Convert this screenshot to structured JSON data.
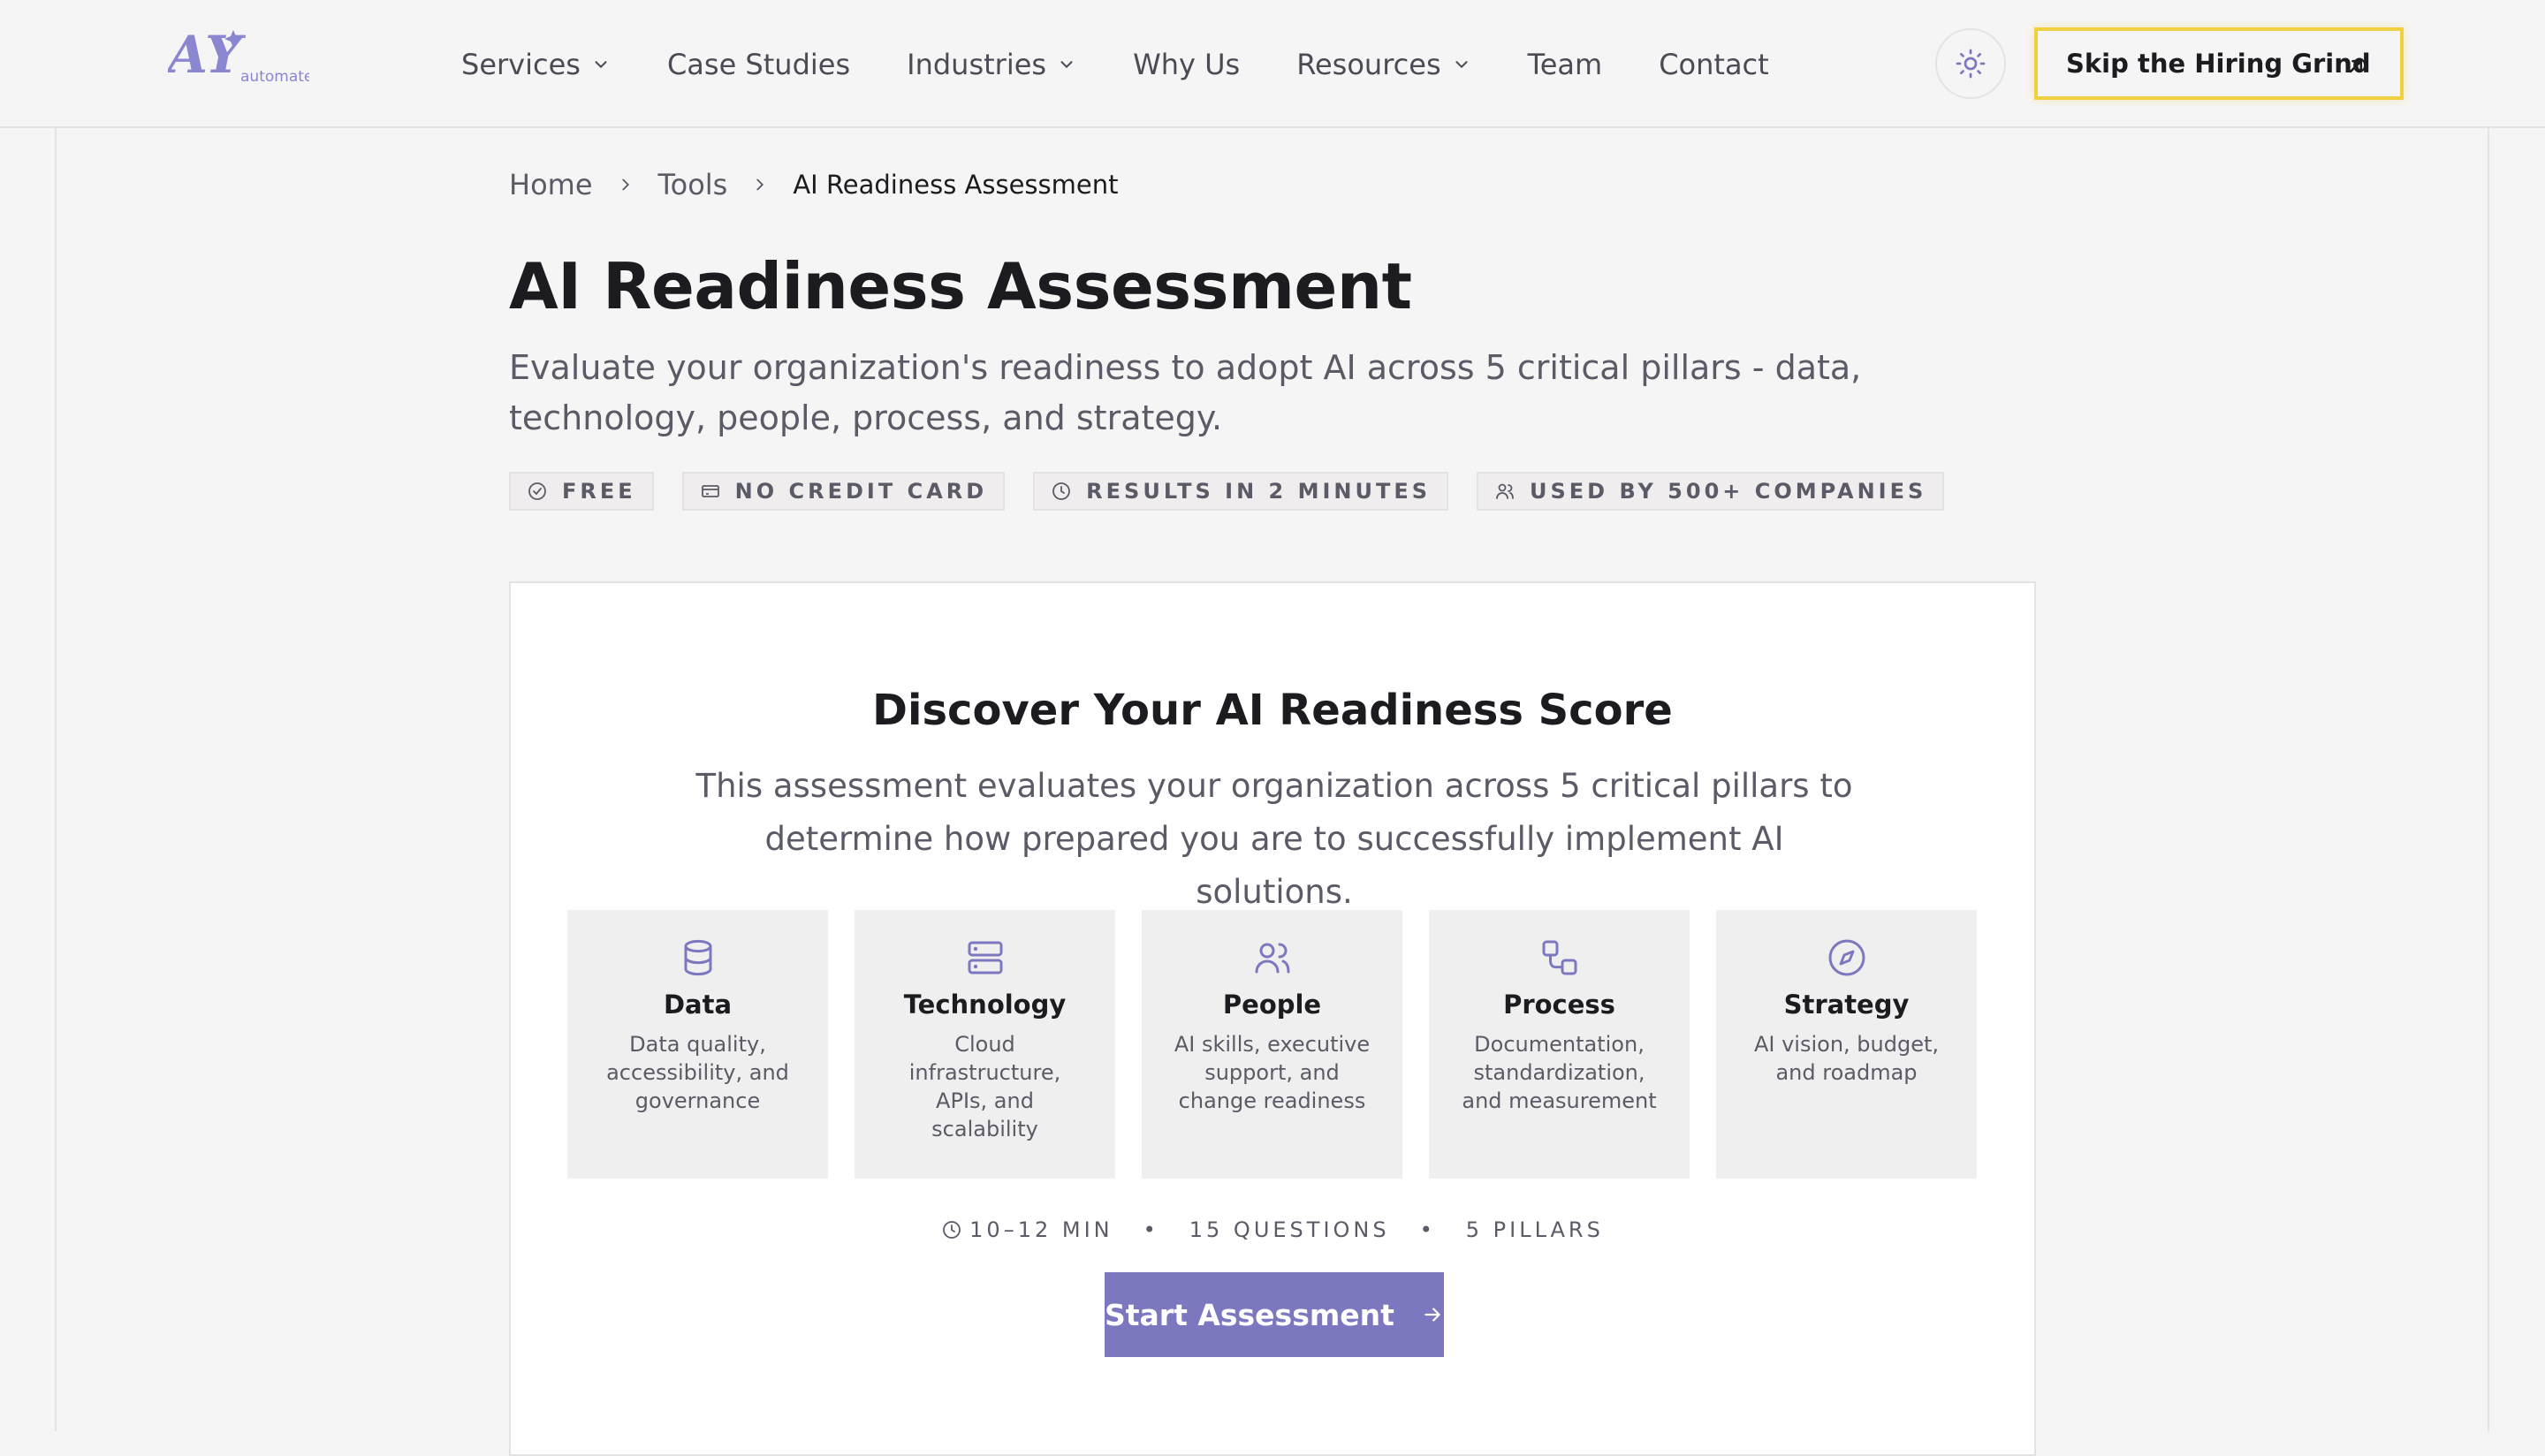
{
  "header": {
    "logo_text": "automate",
    "nav": [
      {
        "label": "Services",
        "dropdown": true
      },
      {
        "label": "Case Studies",
        "dropdown": false
      },
      {
        "label": "Industries",
        "dropdown": true
      },
      {
        "label": "Why Us",
        "dropdown": false
      },
      {
        "label": "Resources",
        "dropdown": true
      },
      {
        "label": "Team",
        "dropdown": false
      },
      {
        "label": "Contact",
        "dropdown": false
      }
    ],
    "theme_toggle_icon": "sun-icon",
    "cta_label": "Skip the Hiring Grind"
  },
  "breadcrumb": {
    "items": [
      "Home",
      "Tools"
    ],
    "current": "AI Readiness Assessment"
  },
  "page": {
    "title": "AI Readiness Assessment",
    "description": "Evaluate your organization's readiness to adopt AI across 5 critical pillars - data, technology, people, process, and strategy.",
    "badges": [
      {
        "icon": "check-circle-icon",
        "label": "FREE"
      },
      {
        "icon": "credit-card-icon",
        "label": "NO CREDIT CARD"
      },
      {
        "icon": "clock-icon",
        "label": "RESULTS IN 2 MINUTES"
      },
      {
        "icon": "users-icon",
        "label": "USED BY 500+ COMPANIES"
      }
    ]
  },
  "card": {
    "title": "Discover Your AI Readiness Score",
    "description": "This assessment evaluates your organization across 5 critical pillars to determine how prepared you are to successfully implement AI solutions.",
    "pillars": [
      {
        "icon": "database-icon",
        "name": "Data",
        "desc": "Data quality, accessibility, and governance"
      },
      {
        "icon": "server-icon",
        "name": "Technology",
        "desc": "Cloud infrastructure, APIs, and scalability"
      },
      {
        "icon": "people-icon",
        "name": "People",
        "desc": "AI skills, executive support, and change readiness"
      },
      {
        "icon": "workflow-icon",
        "name": "Process",
        "desc": "Documentation, standardization, and measurement"
      },
      {
        "icon": "compass-icon",
        "name": "Strategy",
        "desc": "AI vision, budget, and roadmap"
      }
    ],
    "meta": {
      "duration": "10–12 MIN",
      "questions": "15 QUESTIONS",
      "pillars": "5 PILLARS",
      "separator": "•"
    },
    "start_label": "Start Assessment"
  },
  "colors": {
    "accent": "#7c78c0",
    "cta_border": "#f1d03f",
    "background": "#f6f5f5"
  }
}
